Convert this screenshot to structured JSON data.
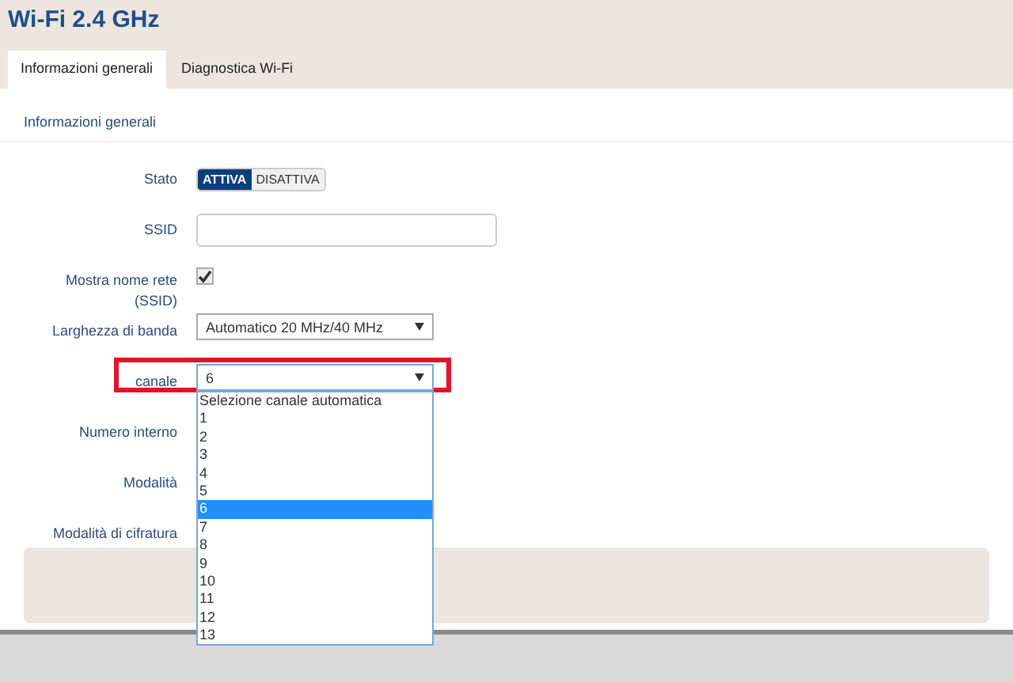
{
  "title": "Wi-Fi 2.4 GHz",
  "tabs": [
    {
      "label": "Informazioni generali",
      "selected": true
    },
    {
      "label": "Diagnostica Wi-Fi",
      "selected": false
    }
  ],
  "section_title": "Informazioni generali",
  "rows": [
    {
      "kind": "toggle",
      "label": "Stato",
      "options": [
        {
          "label": "ATTIVA",
          "selected": true
        },
        {
          "label": "DISATTIVA",
          "selected": false
        }
      ]
    },
    {
      "kind": "text",
      "label": "SSID"
    },
    {
      "kind": "checkbox",
      "label": "Mostra nome rete (SSID)",
      "checked": true
    },
    {
      "kind": "select",
      "label": "Larghezza di banda",
      "value": "Automatico 20 MHz/40 MHz",
      "highlighted": false,
      "open": false
    },
    {
      "kind": "select",
      "label": "canale",
      "value": "6",
      "highlighted": true,
      "open": true,
      "options": [
        {
          "label": "Selezione canale automatica",
          "selected": false
        },
        {
          "label": "1",
          "selected": false
        },
        {
          "label": "2",
          "selected": false
        },
        {
          "label": "3",
          "selected": false
        },
        {
          "label": "4",
          "selected": false
        },
        {
          "label": "5",
          "selected": false
        },
        {
          "label": "6",
          "selected": true
        },
        {
          "label": "7",
          "selected": false
        },
        {
          "label": "8",
          "selected": false
        },
        {
          "label": "9",
          "selected": false
        },
        {
          "label": "10",
          "selected": false
        },
        {
          "label": "11",
          "selected": false
        },
        {
          "label": "12",
          "selected": false
        },
        {
          "label": "13",
          "selected": false
        }
      ]
    },
    {
      "kind": "blank",
      "label": "Numero interno"
    },
    {
      "kind": "blank",
      "label": "Modalità"
    },
    {
      "kind": "blank",
      "label": "Modalità di cifratura"
    }
  ]
}
